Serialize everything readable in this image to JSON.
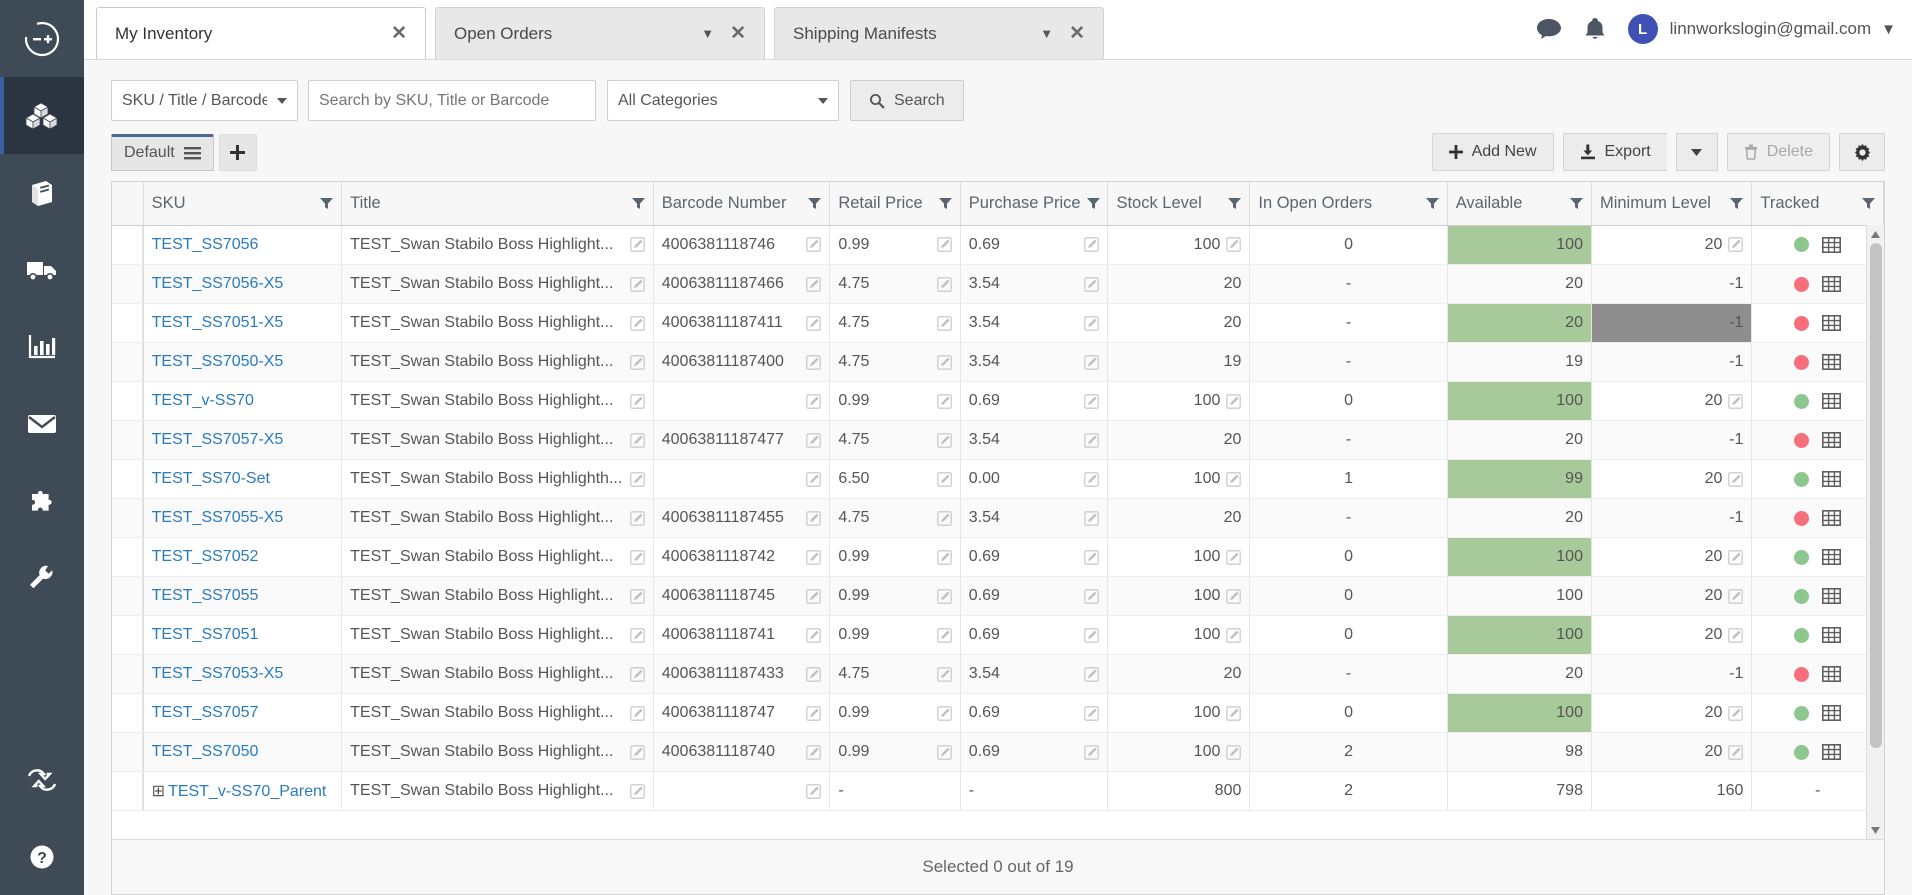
{
  "sidebar": {
    "logo_icon": "linnworks-logo-icon",
    "items": [
      {
        "icon": "boxes-icon",
        "name": "inventory",
        "active": true
      },
      {
        "icon": "book-icon",
        "name": "orders",
        "active": false
      },
      {
        "icon": "truck-icon",
        "name": "shipping",
        "active": false
      },
      {
        "icon": "bar-chart-icon",
        "name": "dashboards",
        "active": false
      },
      {
        "icon": "envelope-icon",
        "name": "email",
        "active": false
      },
      {
        "icon": "puzzle-piece-icon",
        "name": "channel-integration",
        "active": false
      },
      {
        "icon": "wrench-icon",
        "name": "settings",
        "active": false
      }
    ],
    "bottom_items": [
      {
        "icon": "sync-icon",
        "name": "sync"
      },
      {
        "icon": "question-circle-icon",
        "name": "help"
      }
    ]
  },
  "topbar": {
    "tabs": [
      {
        "label": "My Inventory",
        "active": true,
        "has_caret": false,
        "has_close": true
      },
      {
        "label": "Open Orders",
        "active": false,
        "has_caret": true,
        "has_close": true
      },
      {
        "label": "Shipping Manifests",
        "active": false,
        "has_caret": true,
        "has_close": true
      }
    ],
    "chat_icon": "chat-bubble-icon",
    "bell_icon": "bell-icon",
    "avatar_letter": "L",
    "user_email": "linnworkslogin@gmail.com",
    "user_caret": "⌄"
  },
  "search": {
    "field_select_value": "SKU / Title / Barcode",
    "field_select_options": [
      "SKU / Title / Barcode"
    ],
    "input_value": "",
    "input_placeholder": "Search by SKU, Title or Barcode",
    "category_select_value": "All Categories",
    "category_select_options": [
      "All Categories"
    ],
    "search_button_label": "Search",
    "search_icon": "magnifier-icon"
  },
  "views": {
    "default_tab_label": "Default",
    "default_tab_icon": "hamburger-icon",
    "add_view_label": "+"
  },
  "actions": {
    "add_new_label": "Add New",
    "add_new_icon": "plus-icon",
    "export_label": "Export",
    "export_icon": "download-icon",
    "export_caret": "▼",
    "delete_label": "Delete",
    "delete_icon": "trash-icon",
    "settings_icon": "gear-icon"
  },
  "grid": {
    "columns": [
      {
        "key": "sku",
        "label": "SKU"
      },
      {
        "key": "title",
        "label": "Title"
      },
      {
        "key": "barcode",
        "label": "Barcode Number"
      },
      {
        "key": "retail",
        "label": "Retail Price"
      },
      {
        "key": "purchase",
        "label": "Purchase Price"
      },
      {
        "key": "stock",
        "label": "Stock Level"
      },
      {
        "key": "open",
        "label": "In Open Orders"
      },
      {
        "key": "available",
        "label": "Available"
      },
      {
        "key": "minimum",
        "label": "Minimum Level"
      },
      {
        "key": "tracked",
        "label": "Tracked"
      }
    ],
    "filter_icon": "funnel-icon",
    "edit_icon": "pencil-square-icon",
    "tracked_grid_icon": "table-grid-icon",
    "rows": [
      {
        "sku": "TEST_SS7056",
        "title": "TEST_Swan Stabilo Boss Highlight...",
        "barcode": "4006381118746",
        "retail": "0.99",
        "purchase": "0.69",
        "stock": "100",
        "open": "0",
        "available": "100",
        "minimum": "20",
        "tracked": "green",
        "min_neg": false,
        "stock_edit": true,
        "min_edit": true,
        "expandable": false
      },
      {
        "sku": "TEST_SS7056-X5",
        "title": "TEST_Swan Stabilo Boss Highlight...",
        "barcode": "40063811187466",
        "retail": "4.75",
        "purchase": "3.54",
        "stock": "20",
        "open": "-",
        "available": "20",
        "minimum": "-1",
        "tracked": "red",
        "min_neg": true,
        "stock_edit": false,
        "min_edit": false,
        "expandable": false
      },
      {
        "sku": "TEST_SS7051-X5",
        "title": "TEST_Swan Stabilo Boss Highlight...",
        "barcode": "40063811187411",
        "retail": "4.75",
        "purchase": "3.54",
        "stock": "20",
        "open": "-",
        "available": "20",
        "minimum": "-1",
        "tracked": "red",
        "min_neg": true,
        "stock_edit": false,
        "min_edit": false,
        "expandable": false
      },
      {
        "sku": "TEST_SS7050-X5",
        "title": "TEST_Swan Stabilo Boss Highlight...",
        "barcode": "40063811187400",
        "retail": "4.75",
        "purchase": "3.54",
        "stock": "19",
        "open": "-",
        "available": "19",
        "minimum": "-1",
        "tracked": "red",
        "min_neg": true,
        "stock_edit": false,
        "min_edit": false,
        "expandable": false
      },
      {
        "sku": "TEST_v-SS70",
        "title": "TEST_Swan Stabilo Boss Highlight...",
        "barcode": "",
        "retail": "0.99",
        "purchase": "0.69",
        "stock": "100",
        "open": "0",
        "available": "100",
        "minimum": "20",
        "tracked": "green",
        "min_neg": false,
        "stock_edit": true,
        "min_edit": true,
        "expandable": false
      },
      {
        "sku": "TEST_SS7057-X5",
        "title": "TEST_Swan Stabilo Boss Highlight...",
        "barcode": "40063811187477",
        "retail": "4.75",
        "purchase": "3.54",
        "stock": "20",
        "open": "-",
        "available": "20",
        "minimum": "-1",
        "tracked": "red",
        "min_neg": true,
        "stock_edit": false,
        "min_edit": false,
        "expandable": false
      },
      {
        "sku": "TEST_SS70-Set",
        "title": "TEST_Swan Stabilo Boss Highlighth...",
        "barcode": "",
        "retail": "6.50",
        "purchase": "0.00",
        "stock": "100",
        "open": "1",
        "available": "99",
        "minimum": "20",
        "tracked": "green",
        "min_neg": false,
        "stock_edit": true,
        "min_edit": true,
        "expandable": false
      },
      {
        "sku": "TEST_SS7055-X5",
        "title": "TEST_Swan Stabilo Boss Highlight...",
        "barcode": "40063811187455",
        "retail": "4.75",
        "purchase": "3.54",
        "stock": "20",
        "open": "-",
        "available": "20",
        "minimum": "-1",
        "tracked": "red",
        "min_neg": true,
        "stock_edit": false,
        "min_edit": false,
        "expandable": false
      },
      {
        "sku": "TEST_SS7052",
        "title": "TEST_Swan Stabilo Boss Highlight...",
        "barcode": "4006381118742",
        "retail": "0.99",
        "purchase": "0.69",
        "stock": "100",
        "open": "0",
        "available": "100",
        "minimum": "20",
        "tracked": "green",
        "min_neg": false,
        "stock_edit": true,
        "min_edit": true,
        "expandable": false
      },
      {
        "sku": "TEST_SS7055",
        "title": "TEST_Swan Stabilo Boss Highlight...",
        "barcode": "4006381118745",
        "retail": "0.99",
        "purchase": "0.69",
        "stock": "100",
        "open": "0",
        "available": "100",
        "minimum": "20",
        "tracked": "green",
        "min_neg": false,
        "stock_edit": true,
        "min_edit": true,
        "expandable": false
      },
      {
        "sku": "TEST_SS7051",
        "title": "TEST_Swan Stabilo Boss Highlight...",
        "barcode": "4006381118741",
        "retail": "0.99",
        "purchase": "0.69",
        "stock": "100",
        "open": "0",
        "available": "100",
        "minimum": "20",
        "tracked": "green",
        "min_neg": false,
        "stock_edit": true,
        "min_edit": true,
        "expandable": false
      },
      {
        "sku": "TEST_SS7053-X5",
        "title": "TEST_Swan Stabilo Boss Highlight...",
        "barcode": "40063811187433",
        "retail": "4.75",
        "purchase": "3.54",
        "stock": "20",
        "open": "-",
        "available": "20",
        "minimum": "-1",
        "tracked": "red",
        "min_neg": true,
        "stock_edit": false,
        "min_edit": false,
        "expandable": false
      },
      {
        "sku": "TEST_SS7057",
        "title": "TEST_Swan Stabilo Boss Highlight...",
        "barcode": "4006381118747",
        "retail": "0.99",
        "purchase": "0.69",
        "stock": "100",
        "open": "0",
        "available": "100",
        "minimum": "20",
        "tracked": "green",
        "min_neg": false,
        "stock_edit": true,
        "min_edit": true,
        "expandable": false
      },
      {
        "sku": "TEST_SS7050",
        "title": "TEST_Swan Stabilo Boss Highlight...",
        "barcode": "4006381118740",
        "retail": "0.99",
        "purchase": "0.69",
        "stock": "100",
        "open": "2",
        "available": "98",
        "minimum": "20",
        "tracked": "green",
        "min_neg": false,
        "stock_edit": true,
        "min_edit": true,
        "expandable": false
      },
      {
        "sku": "TEST_v-SS70_Parent",
        "title": "TEST_Swan Stabilo Boss Highlight...",
        "barcode": "",
        "retail": "-",
        "purchase": "-",
        "stock": "800",
        "open": "2",
        "available": "798",
        "minimum": "160",
        "tracked": "dash",
        "min_neg": false,
        "stock_edit": false,
        "min_edit": false,
        "expandable": true
      }
    ],
    "footer_text": "Selected 0 out of 19"
  },
  "colors": {
    "sidebar_bg": "#3f4a57",
    "sidebar_active": "#2b3441",
    "accent_blue": "#2a7bbd",
    "available_green": "#a8c99a",
    "min_negative_gray": "#8e8e8e",
    "dot_green": "#8dc78d",
    "dot_red": "#f76f7a",
    "avatar_blue": "#3f51b5"
  }
}
